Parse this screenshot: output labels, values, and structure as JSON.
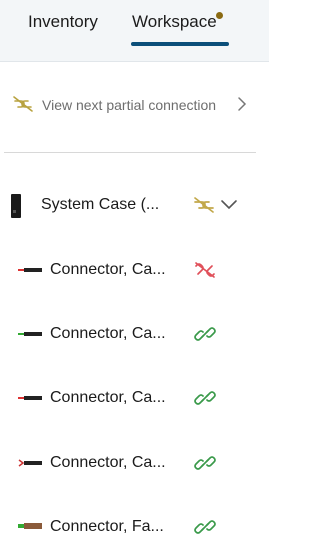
{
  "tabs": [
    {
      "label": "Inventory"
    },
    {
      "label": "Workspace"
    }
  ],
  "partial_connection": {
    "label": "View next partial connection",
    "icon": "partial-link-icon",
    "color": "#b8a23f"
  },
  "tree": {
    "parent": {
      "label": "System Case (...",
      "status_icon": "partial-link-icon",
      "status_color": "#c2a84a"
    },
    "children": [
      {
        "label": "Connector, Ca...",
        "status_icon": "broken-link-icon",
        "status_color": "#e0505a"
      },
      {
        "label": "Connector, Ca...",
        "status_icon": "connected-link-icon",
        "status_color": "#3b9a4b"
      },
      {
        "label": "Connector, Ca...",
        "status_icon": "connected-link-icon",
        "status_color": "#3b9a4b"
      },
      {
        "label": "Connector, Ca...",
        "status_icon": "connected-link-icon",
        "status_color": "#3b9a4b"
      },
      {
        "label": "Connector, Fa...",
        "status_icon": "connected-link-icon",
        "status_color": "#3b9a4b"
      }
    ]
  },
  "colors": {
    "active_tab_underline": "#0b4f7a",
    "notification_dot": "#8a6a12"
  }
}
